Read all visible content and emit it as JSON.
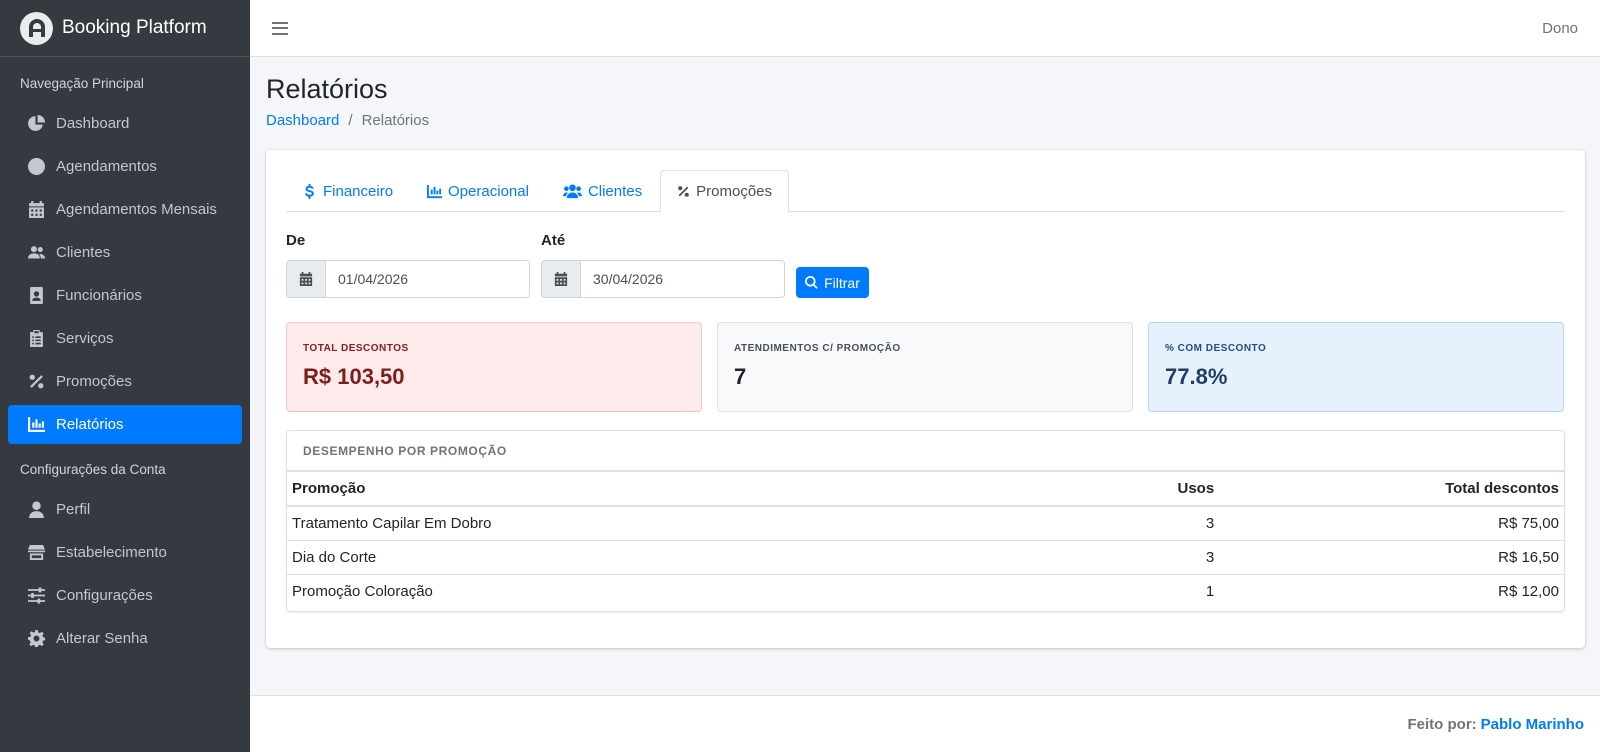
{
  "brand": {
    "name": "Booking Platform"
  },
  "sidebar": {
    "header_main": "Navegação Principal",
    "header_account": "Configurações da Conta",
    "items": [
      {
        "label": "Dashboard",
        "icon": "chart-pie-icon"
      },
      {
        "label": "Agendamentos",
        "icon": "clock-icon"
      },
      {
        "label": "Agendamentos Mensais",
        "icon": "calendar-icon"
      },
      {
        "label": "Clientes",
        "icon": "users-icon"
      },
      {
        "label": "Funcionários",
        "icon": "id-badge-icon"
      },
      {
        "label": "Serviços",
        "icon": "clipboard-list-icon"
      },
      {
        "label": "Promoções",
        "icon": "percent-icon"
      },
      {
        "label": "Relatórios",
        "icon": "bar-chart-icon",
        "active": true
      }
    ],
    "account_items": [
      {
        "label": "Perfil",
        "icon": "user-icon"
      },
      {
        "label": "Estabelecimento",
        "icon": "store-icon"
      },
      {
        "label": "Configurações",
        "icon": "sliders-icon"
      },
      {
        "label": "Alterar Senha",
        "icon": "gear-icon"
      }
    ]
  },
  "navbar": {
    "user": "Dono"
  },
  "page": {
    "title": "Relatórios",
    "breadcrumb": {
      "home": "Dashboard",
      "separator": "/",
      "current": "Relatórios"
    }
  },
  "tabs": [
    {
      "label": "Financeiro",
      "icon": "dollar-icon"
    },
    {
      "label": "Operacional",
      "icon": "bar-chart-icon"
    },
    {
      "label": "Clientes",
      "icon": "users-icon"
    },
    {
      "label": "Promoções",
      "icon": "percent-icon",
      "active": true
    }
  ],
  "filter": {
    "from_label": "De",
    "from_value": "01/04/2026",
    "to_label": "Até",
    "to_value": "30/04/2026",
    "button_label": "Filtrar"
  },
  "stats": {
    "total_descontos": {
      "label": "Total Descontos",
      "value": "R$ 103,50"
    },
    "atendimentos": {
      "label": "Atendimentos C/ Promoção",
      "value": "7"
    },
    "percent": {
      "label": "% Com Desconto",
      "value": "77.8%"
    }
  },
  "performance": {
    "title": "DESEMPENHO POR PROMOÇÃO",
    "columns": [
      "Promoção",
      "Usos",
      "Total descontos"
    ],
    "rows": [
      [
        "Tratamento Capilar Em Dobro",
        "3",
        "R$ 75,00"
      ],
      [
        "Dia do Corte",
        "3",
        "R$ 16,50"
      ],
      [
        "Promoção Coloração",
        "1",
        "R$ 12,00"
      ]
    ]
  },
  "footer": {
    "prefix": "Feito por:",
    "author": "Pablo Marinho"
  },
  "colors": {
    "accent": "#007bff",
    "sidebar_bg": "#343a40"
  }
}
